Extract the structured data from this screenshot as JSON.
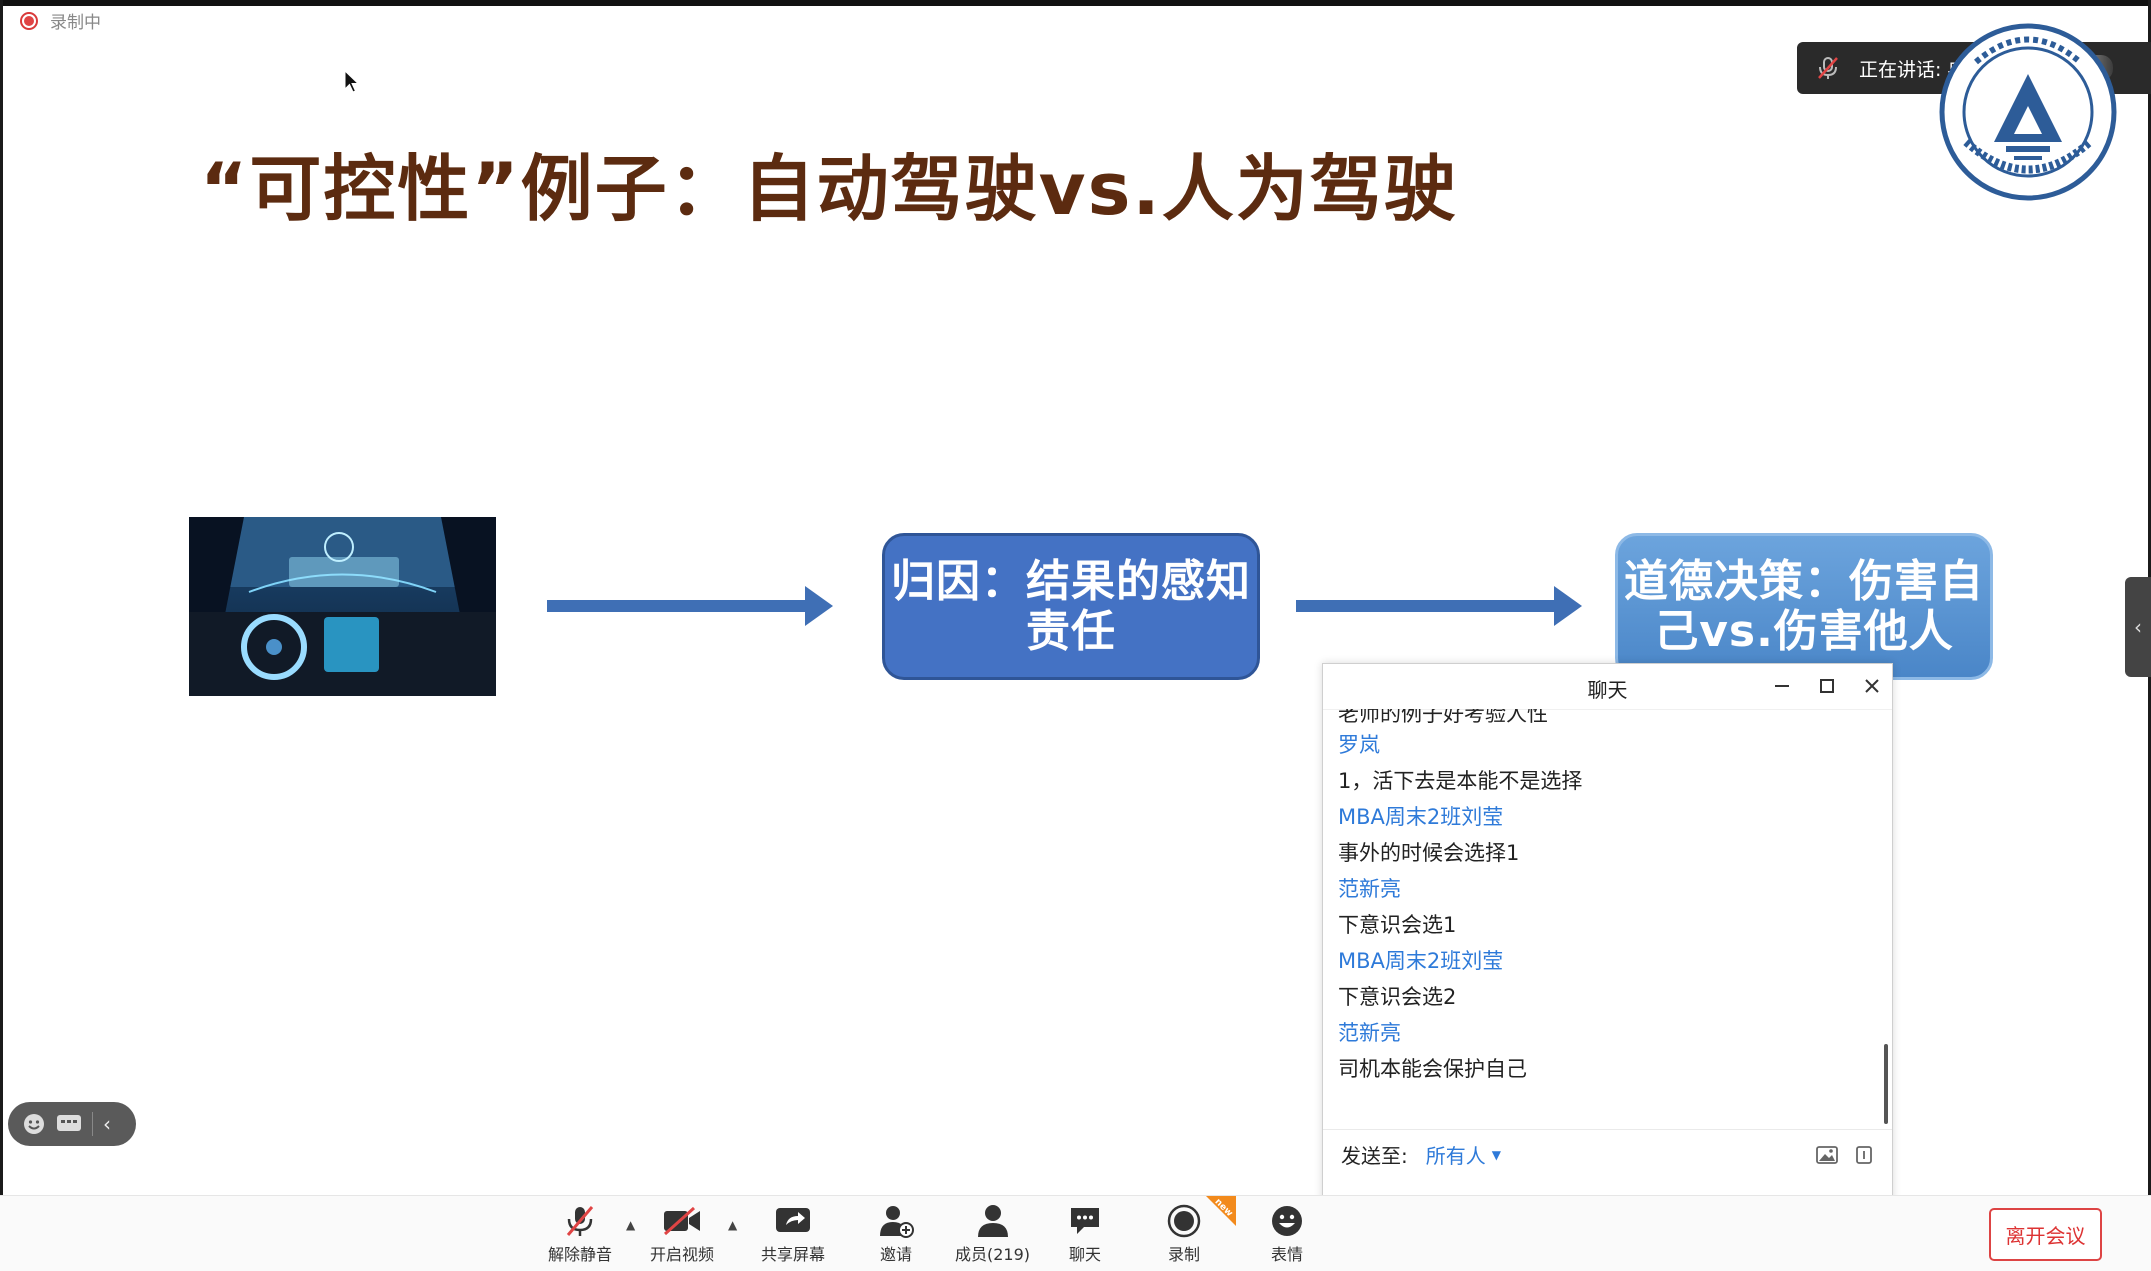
{
  "recording": {
    "label": "录制中"
  },
  "speaking": {
    "label": "正在讲话: 冉雅璇;"
  },
  "slide": {
    "title": "“可控性”例子：自动驾驶vs.人为驾驶",
    "box1_line1": "归因：结果的感知",
    "box1_line2": "责任",
    "box2_line1": "道德决策：伤害自",
    "box2_line2": "己vs.伤害他人"
  },
  "chat": {
    "title": "聊天",
    "messages": [
      {
        "kind": "text",
        "text": "老师的例子好考验人性"
      },
      {
        "kind": "name",
        "text": "罗岚"
      },
      {
        "kind": "text",
        "text": "1，活下去是本能不是选择"
      },
      {
        "kind": "name",
        "text": "MBA周末2班刘莹"
      },
      {
        "kind": "text",
        "text": "事外的时候会选择1"
      },
      {
        "kind": "name",
        "text": "范新亮"
      },
      {
        "kind": "text",
        "text": "下意识会选1"
      },
      {
        "kind": "name",
        "text": "MBA周末2班刘莹"
      },
      {
        "kind": "text",
        "text": "下意识会选2"
      },
      {
        "kind": "name",
        "text": "范新亮"
      },
      {
        "kind": "text",
        "text": "司机本能会保护自己"
      }
    ],
    "send_to_label": "发送至:",
    "send_to_value": "所有人"
  },
  "toolbar": {
    "unmute": "解除静音",
    "video": "开启视频",
    "share": "共享屏幕",
    "invite": "邀请",
    "members": "成员(219)",
    "chat": "聊天",
    "record": "录制",
    "record_badge": "new",
    "reaction": "表情",
    "leave": "离开会议"
  },
  "colors": {
    "title": "#5c2b10",
    "box1": "#4472c4",
    "box2": "#5b9bd5",
    "arrow": "#3f6fb5",
    "chat_name": "#2e7ad9",
    "leave": "#dd3333"
  }
}
